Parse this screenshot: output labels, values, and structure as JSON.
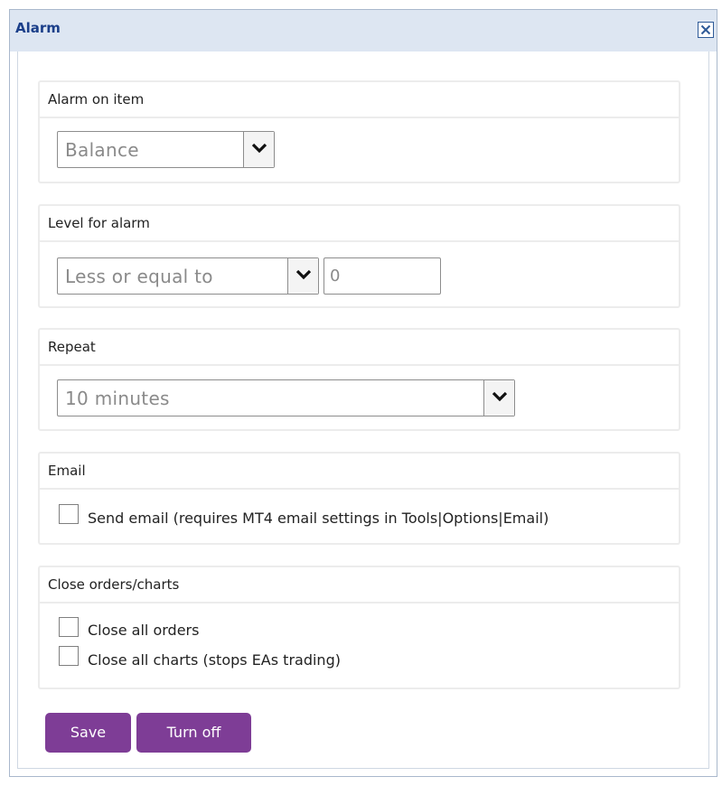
{
  "dialog": {
    "title": "Alarm",
    "close_icon": "close-icon"
  },
  "alarm_on_item": {
    "heading": "Alarm on item",
    "selected": "Balance"
  },
  "level": {
    "heading": "Level for alarm",
    "comparison_selected": "Less or equal to",
    "value": "0"
  },
  "repeat": {
    "heading": "Repeat",
    "selected": "10 minutes"
  },
  "email": {
    "heading": "Email",
    "send_email_label": "Send email (requires MT4 email settings in Tools|Options|Email)",
    "send_email_checked": false
  },
  "close_orders": {
    "heading": "Close orders/charts",
    "close_all_orders_label": "Close all orders",
    "close_all_orders_checked": false,
    "close_all_charts_label": "Close all charts (stops EAs trading)",
    "close_all_charts_checked": false
  },
  "buttons": {
    "save_label": "Save",
    "turn_off_label": "Turn off"
  },
  "colors": {
    "button_bg": "#7e3d96",
    "titlebar_bg": "#dde6f2",
    "title_text": "#1b3f8a"
  }
}
